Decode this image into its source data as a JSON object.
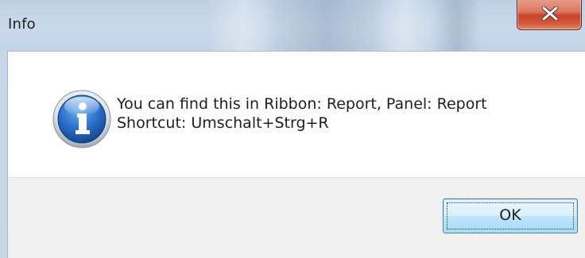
{
  "window": {
    "title": "Info"
  },
  "dialog": {
    "icon": "info-icon",
    "message_line1": "You can find this in Ribbon: Report, Panel: Report",
    "message_line2": "Shortcut: Umschalt+Strg+R"
  },
  "buttons": {
    "ok_label": "OK",
    "close_icon": "close-icon"
  },
  "colors": {
    "close_button": "#c9452e",
    "ok_button_border": "#3c7fb1",
    "info_icon": "#1f5fb3",
    "button_bar": "#f0f0f0"
  }
}
